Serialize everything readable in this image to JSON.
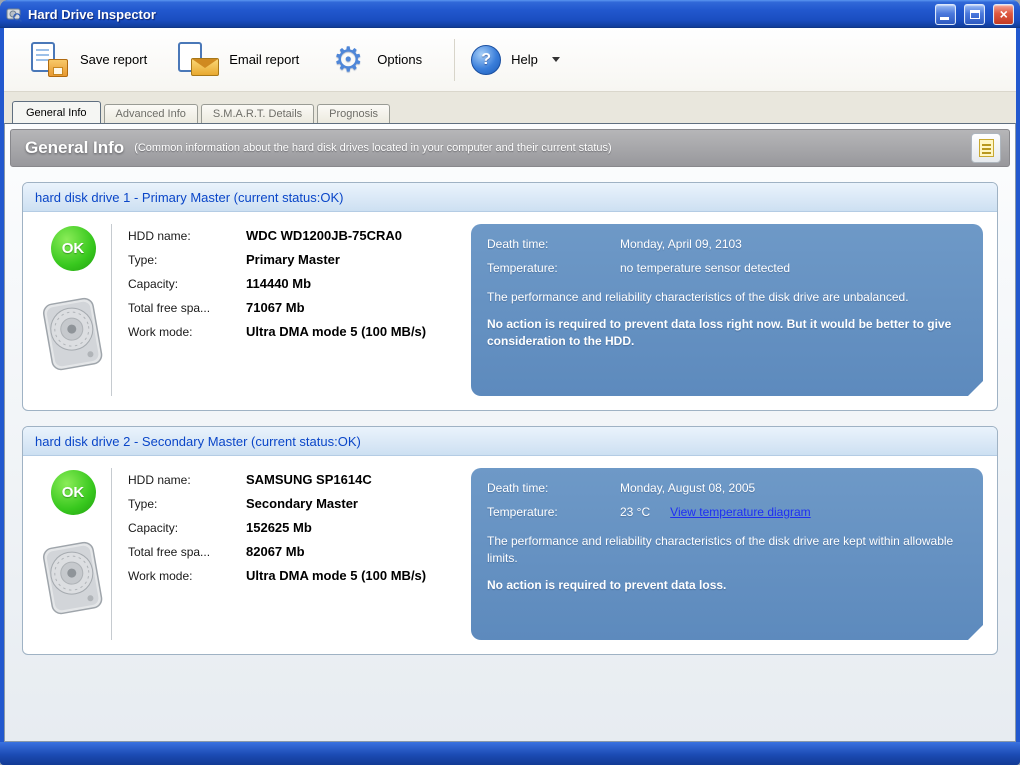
{
  "window": {
    "title": "Hard Drive Inspector"
  },
  "icons": {
    "options_gear": "⚙",
    "help_question": "?",
    "window_close": "×"
  },
  "toolbar": {
    "save_report": "Save report",
    "email_report": "Email report",
    "options": "Options",
    "help": "Help"
  },
  "tabs": [
    {
      "label": "General Info",
      "active": true
    },
    {
      "label": "Advanced Info",
      "active": false
    },
    {
      "label": "S.M.A.R.T. Details",
      "active": false
    },
    {
      "label": "Prognosis",
      "active": false
    }
  ],
  "header": {
    "title": "General Info",
    "subtitle": "(Common information about the hard disk drives located in your computer and their current status)"
  },
  "drives": [
    {
      "title": "hard disk drive 1 - Primary Master (current status:OK)",
      "status": "OK",
      "fields": [
        {
          "label": "HDD name:",
          "value": "WDC WD1200JB-75CRA0"
        },
        {
          "label": "Type:",
          "value": "Primary Master"
        },
        {
          "label": "Capacity:",
          "value": "114440 Mb"
        },
        {
          "label": "Total free spa...",
          "value": "71067 Mb"
        },
        {
          "label": "Work mode:",
          "value": "Ultra DMA mode 5 (100 MB/s)"
        }
      ],
      "info": {
        "death_time_label": "Death time:",
        "death_time": "Monday, April 09, 2103",
        "temperature_label": "Temperature:",
        "temperature": "no temperature sensor detected",
        "description": "The performance and reliability characteristics of the disk drive are unbalanced.",
        "advice": "No action is required to prevent data loss right now. But it would be better to give consideration to the HDD."
      }
    },
    {
      "title": "hard disk drive 2 - Secondary Master (current status:OK)",
      "status": "OK",
      "fields": [
        {
          "label": "HDD name:",
          "value": "SAMSUNG SP1614C"
        },
        {
          "label": "Type:",
          "value": "Secondary Master"
        },
        {
          "label": "Capacity:",
          "value": "152625 Mb"
        },
        {
          "label": "Total free spa...",
          "value": "82067 Mb"
        },
        {
          "label": "Work mode:",
          "value": "Ultra DMA mode 5 (100 MB/s)"
        }
      ],
      "info": {
        "death_time_label": "Death time:",
        "death_time": "Monday, August 08, 2005",
        "temperature_label": "Temperature:",
        "temperature": "23 °C",
        "temperature_link": "View temperature diagram",
        "description": "The performance and reliability characteristics of the disk drive are kept within allowable limits.",
        "advice": "No action is required to prevent data loss."
      }
    }
  ],
  "colors": {
    "status_ok": "#2FB81E",
    "info_panel": "#6492C3",
    "link": "#1E2FF2",
    "frame_blue": "#2258CE",
    "drive_header_text": "#0A46C8"
  }
}
